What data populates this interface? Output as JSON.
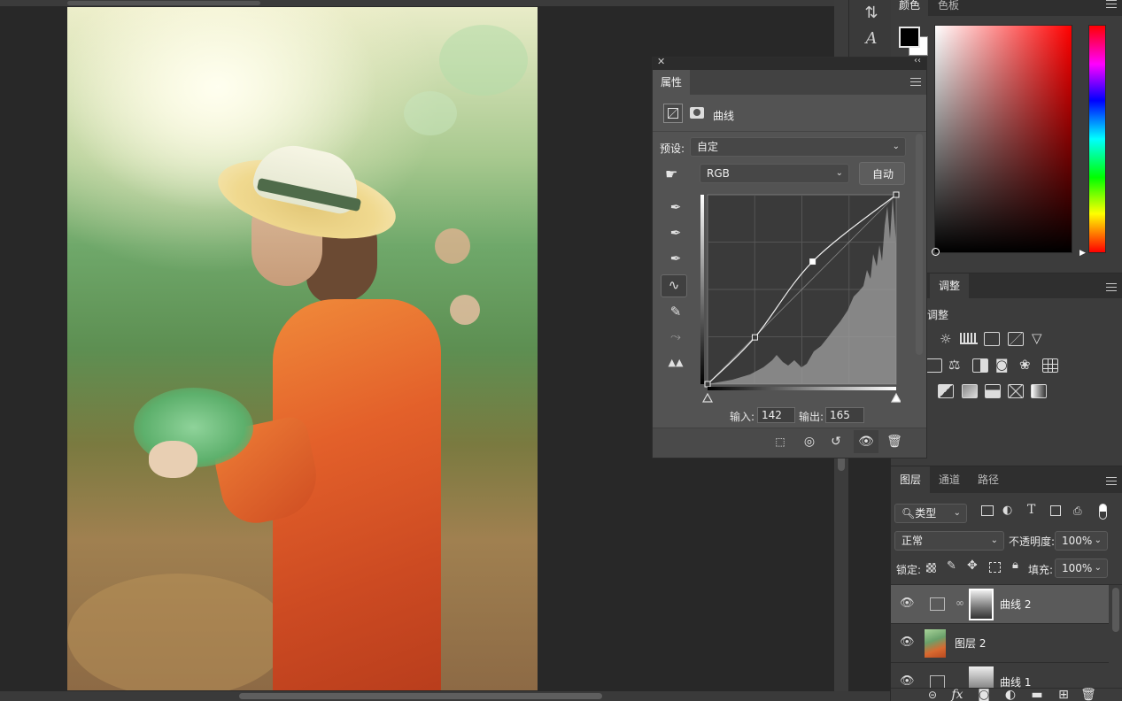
{
  "properties_panel": {
    "tab": "属性",
    "layer_type": "曲线",
    "preset_label": "预设:",
    "preset_value": "自定",
    "channel_value": "RGB",
    "auto_button": "自动",
    "input_label": "输入:",
    "input_value": "142",
    "output_label": "输出:",
    "output_value": "165"
  },
  "color_panel": {
    "tabs": [
      "颜色",
      "色板"
    ],
    "foreground": "#000000",
    "background": "#ffffff"
  },
  "adjustments_panel": {
    "tab": "调整",
    "add_label": "调整"
  },
  "layers_panel": {
    "tabs": [
      "图层",
      "通道",
      "路径"
    ],
    "filter_kind": "类型",
    "blend_mode": "正常",
    "opacity_label": "不透明度:",
    "opacity_value": "100%",
    "lock_label": "锁定:",
    "fill_label": "填充:",
    "fill_value": "100%",
    "layers": [
      {
        "name": "曲线 2",
        "type": "curves-adjustment",
        "visible": true,
        "selected": true
      },
      {
        "name": "图层 2",
        "type": "pixel",
        "visible": true,
        "selected": false
      },
      {
        "name": "曲线 1",
        "type": "curves-adjustment",
        "visible": true,
        "selected": false
      }
    ]
  },
  "curve": {
    "points": [
      [
        0,
        0
      ],
      [
        64,
        63
      ],
      [
        142,
        165
      ],
      [
        255,
        255
      ]
    ]
  }
}
